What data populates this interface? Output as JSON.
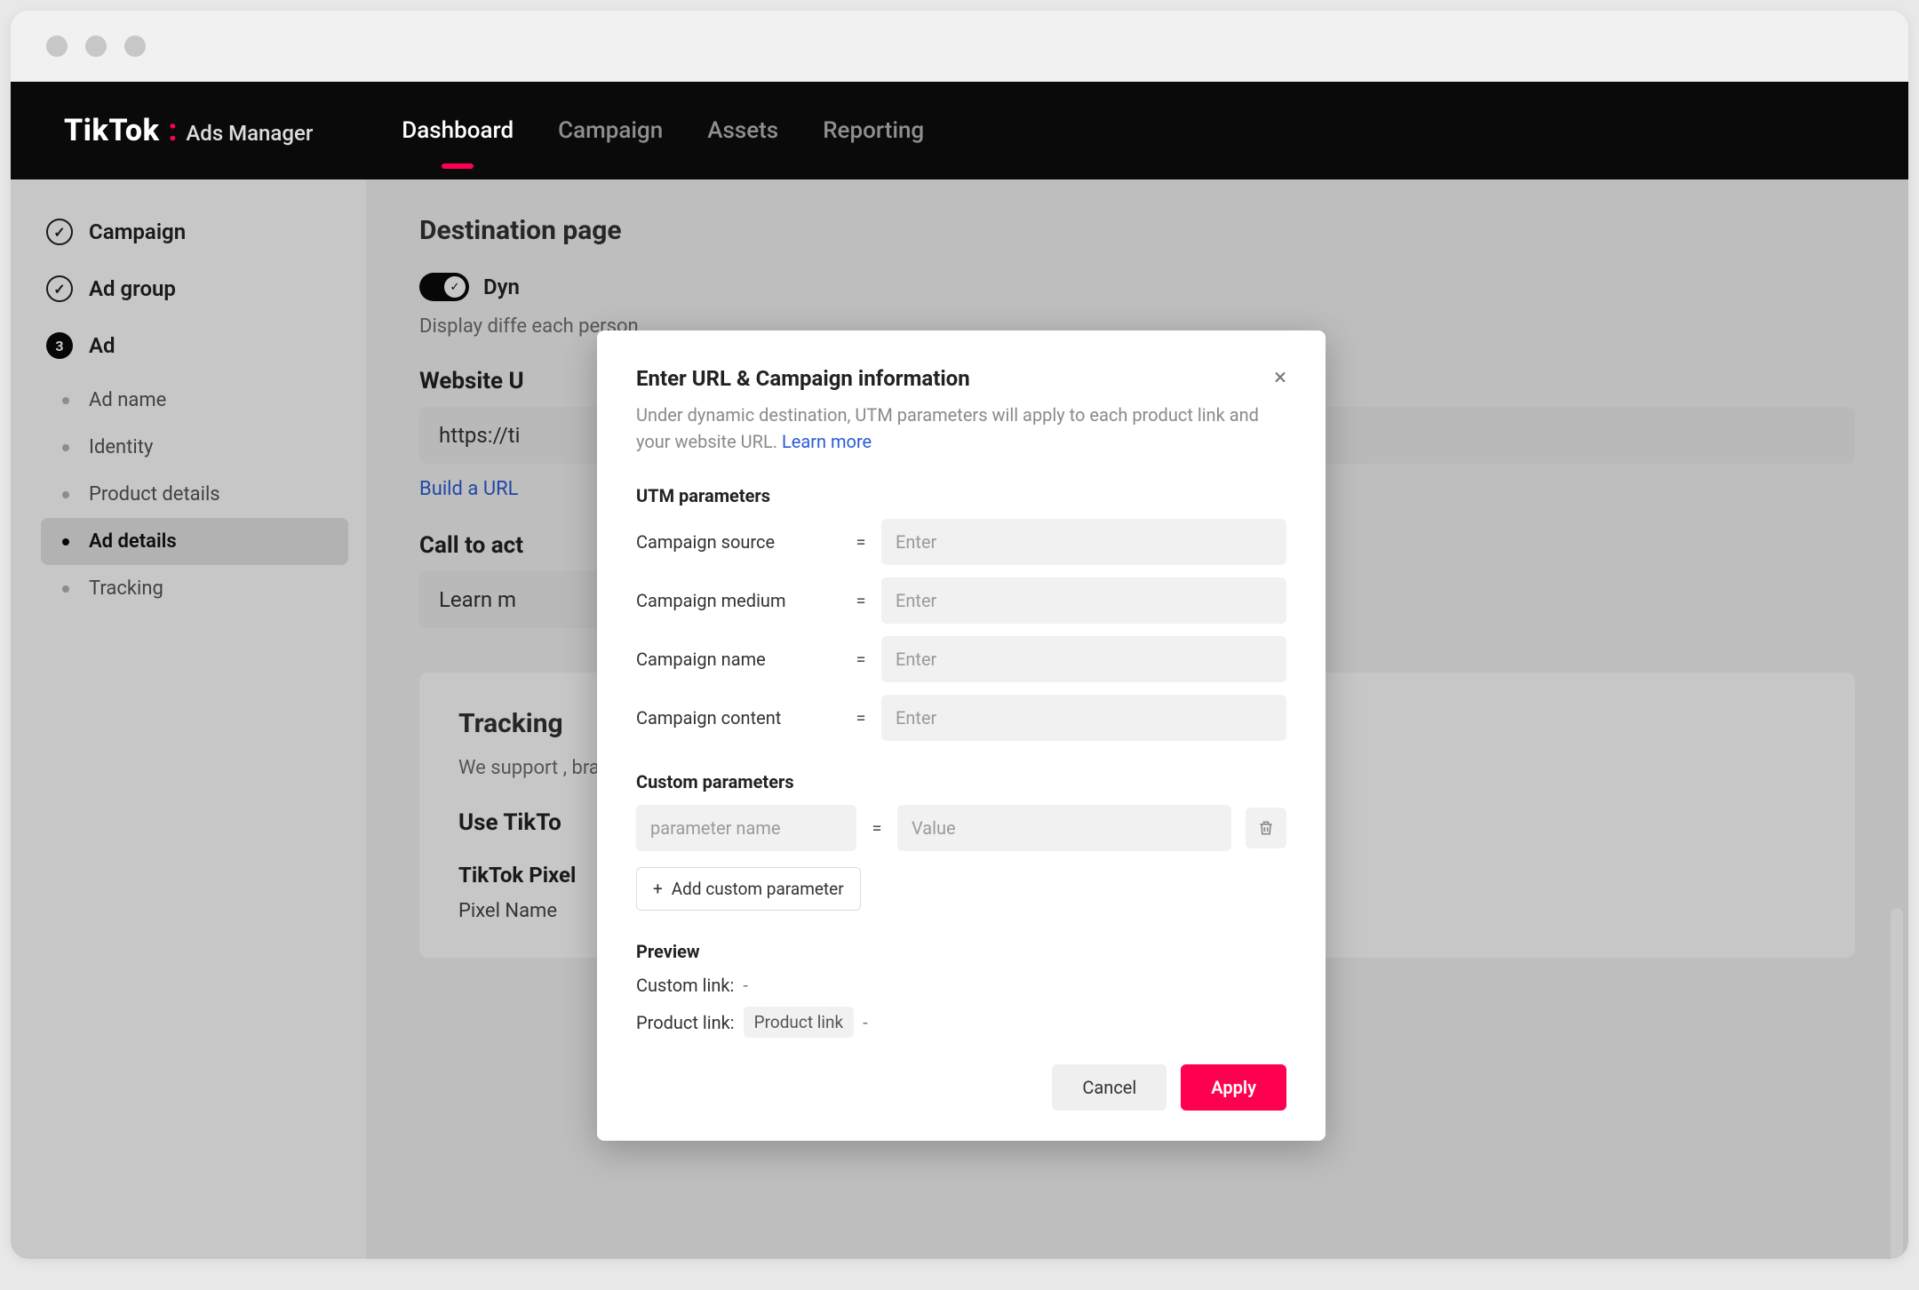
{
  "brand": {
    "name": "TikTok",
    "suffix": "Ads Manager"
  },
  "nav": {
    "items": [
      {
        "label": "Dashboard",
        "active": true
      },
      {
        "label": "Campaign"
      },
      {
        "label": "Assets"
      },
      {
        "label": "Reporting"
      }
    ]
  },
  "sidebar": {
    "steps": [
      {
        "label": "Campaign",
        "state": "done"
      },
      {
        "label": "Ad group",
        "state": "done"
      },
      {
        "label": "Ad",
        "state": "current",
        "number": "3"
      }
    ],
    "substeps": [
      {
        "label": "Ad name"
      },
      {
        "label": "Identity"
      },
      {
        "label": "Product details"
      },
      {
        "label": "Ad details",
        "active": true
      },
      {
        "label": "Tracking"
      }
    ]
  },
  "main": {
    "destination": {
      "title": "Destination page",
      "toggle_label": "Dyn",
      "body": "Display diffe each person",
      "url_label": "Website U",
      "url_value": "https://ti",
      "build_link": "Build a URL",
      "cta_label": "Call to act",
      "cta_value": "Learn m"
    },
    "tracking": {
      "title": "Tracking",
      "body": "We support , brand safety partners, and vieability verification",
      "pixel_heading": "Use TikTo",
      "pixel_sub": "TikTok Pixel",
      "pixel_name": "Pixel Name"
    }
  },
  "modal": {
    "title": "Enter URL & Campaign information",
    "description": "Under dynamic destination, UTM parameters will apply to each product link and your website URL. ",
    "learn_more": "Learn more",
    "utm_title": "UTM parameters",
    "utm": [
      {
        "label": "Campaign source",
        "placeholder": "Enter"
      },
      {
        "label": "Campaign medium",
        "placeholder": "Enter"
      },
      {
        "label": "Campaign name",
        "placeholder": "Enter"
      },
      {
        "label": "Campaign content",
        "placeholder": "Enter"
      }
    ],
    "custom_title": "Custom parameters",
    "custom_name_placeholder": "parameter name",
    "custom_value_placeholder": "Value",
    "add_button": "Add custom parameter",
    "preview_title": "Preview",
    "preview_custom_label": "Custom link:",
    "preview_custom_value": "-",
    "preview_product_label": "Product link:",
    "preview_product_chip": "Product link",
    "preview_product_suffix": "-",
    "cancel": "Cancel",
    "apply": "Apply"
  }
}
